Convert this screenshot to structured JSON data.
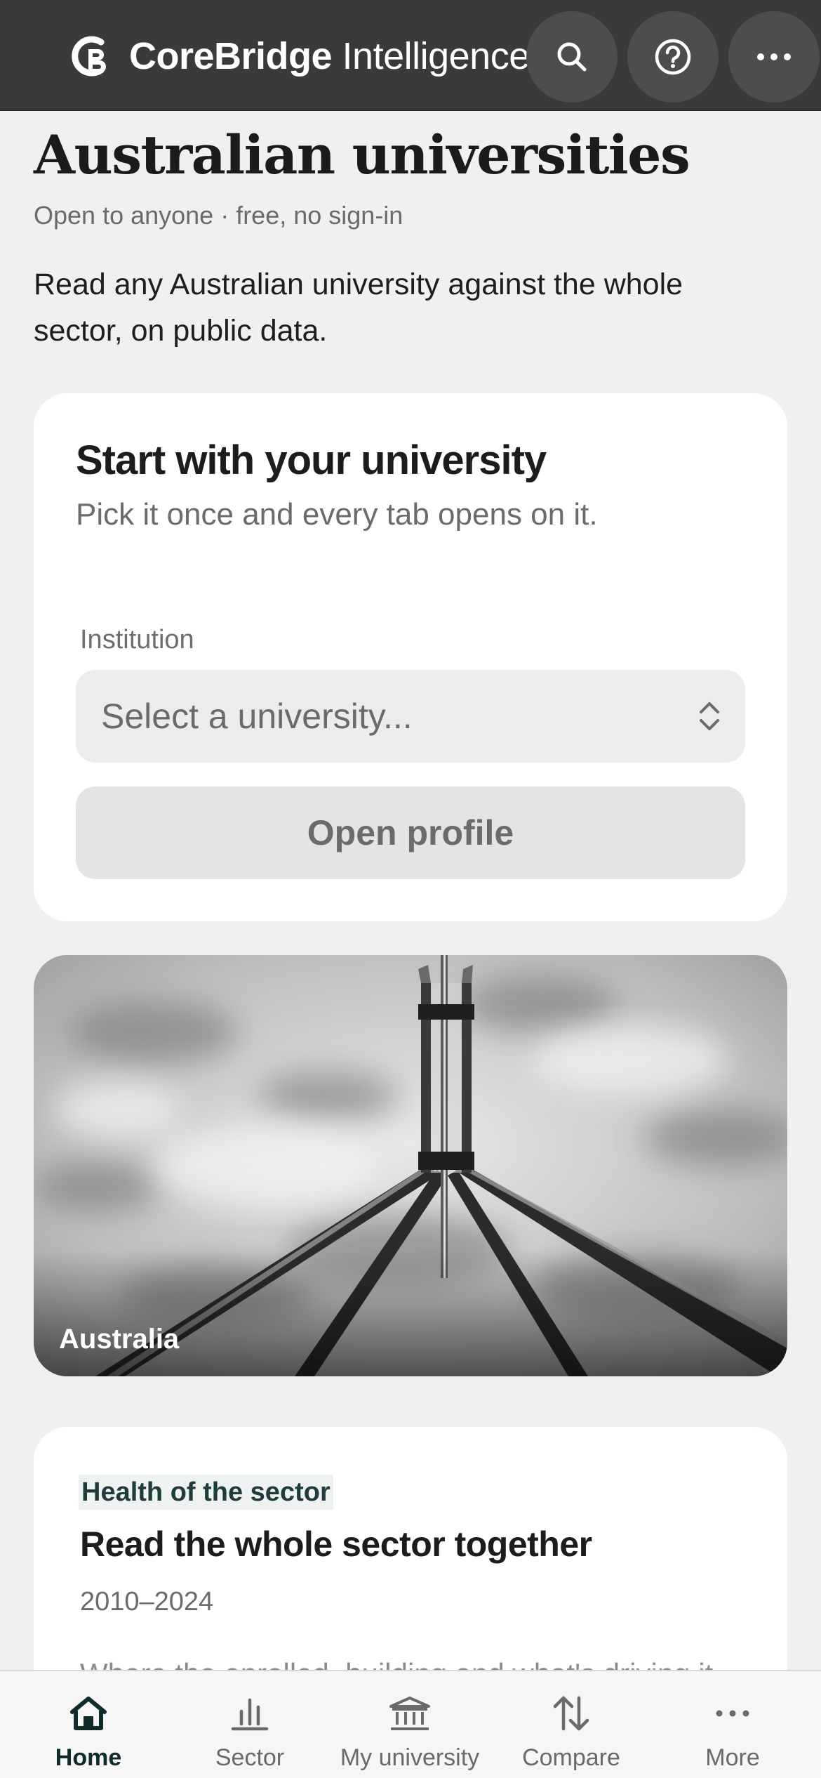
{
  "app": {
    "brand_bold": "CoreBridge",
    "brand_light": " Intelligence",
    "accent": "#0f2b2b",
    "topbar_color": "#3a3a39"
  },
  "topbar": {
    "actions": [
      {
        "icon": "search-icon"
      },
      {
        "icon": "help-icon"
      },
      {
        "icon": "more-icon"
      }
    ]
  },
  "header": {
    "title": "Australian universities",
    "access_note": "Open to anyone · free, no sign-in",
    "intro": "Read any Australian university against the whole sector, on public data."
  },
  "picker": {
    "title": "Start with your university",
    "subtitle": "Pick it once and every tab opens on it.",
    "field_label": "Institution",
    "placeholder": "Select a university...",
    "button_label": "Open profile"
  },
  "photo": {
    "caption": "Australia"
  },
  "sector_card": {
    "eyebrow": "Health of the sector",
    "title": "Read the whole sector together",
    "range": "2010–2024",
    "teaser": "Where the enrolled, building and what's driving it"
  },
  "bottom_nav": [
    {
      "label": "Home",
      "icon": "home-icon",
      "active": true
    },
    {
      "label": "Sector",
      "icon": "bar-chart-icon",
      "active": false
    },
    {
      "label": "My university",
      "icon": "institution-icon",
      "active": false
    },
    {
      "label": "Compare",
      "icon": "compare-arrows-icon",
      "active": false
    },
    {
      "label": "More",
      "icon": "more-icon",
      "active": false
    }
  ]
}
